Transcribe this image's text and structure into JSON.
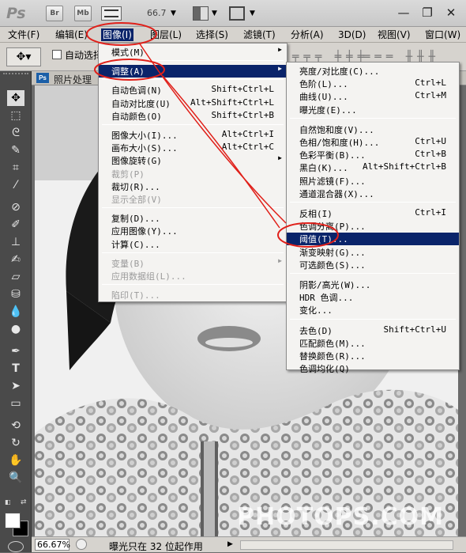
{
  "titlebar": {
    "app_logo": "Ps",
    "btn_bridge": "Br",
    "btn_minibridge": "Mb",
    "zoom": "66.7",
    "icons": [
      "screen-mode-icon",
      "arrange-icon",
      "extras-icon"
    ],
    "win_controls": [
      "minimize",
      "restore",
      "close"
    ]
  },
  "menubar": [
    {
      "label": "文件(F)"
    },
    {
      "label": "编辑(E)"
    },
    {
      "label": "图像(I)",
      "active": true
    },
    {
      "label": "图层(L)"
    },
    {
      "label": "选择(S)"
    },
    {
      "label": "滤镜(T)"
    },
    {
      "label": "分析(A)"
    },
    {
      "label": "3D(D)"
    },
    {
      "label": "视图(V)"
    },
    {
      "label": "窗口(W)"
    }
  ],
  "options": {
    "auto_select": "自动选择"
  },
  "document": {
    "tab_title": "照片处理"
  },
  "status": {
    "zoom": "66.67%",
    "message": "曝光只在 32 位起作用"
  },
  "image_menu": [
    {
      "label": "模式(M)",
      "sub": true
    },
    {
      "sep": true
    },
    {
      "label": "调整(A)",
      "sub": true,
      "hl": true
    },
    {
      "sep": true
    },
    {
      "label": "自动色调(N)",
      "sc": "Shift+Ctrl+L"
    },
    {
      "label": "自动对比度(U)",
      "sc": "Alt+Shift+Ctrl+L"
    },
    {
      "label": "自动颜色(O)",
      "sc": "Shift+Ctrl+B"
    },
    {
      "sep": true
    },
    {
      "label": "图像大小(I)...",
      "sc": "Alt+Ctrl+I"
    },
    {
      "label": "画布大小(S)...",
      "sc": "Alt+Ctrl+C"
    },
    {
      "label": "图像旋转(G)",
      "sub": true
    },
    {
      "label": "裁剪(P)",
      "dis": true
    },
    {
      "label": "裁切(R)..."
    },
    {
      "label": "显示全部(V)",
      "dis": true
    },
    {
      "sep": true
    },
    {
      "label": "复制(D)..."
    },
    {
      "label": "应用图像(Y)..."
    },
    {
      "label": "计算(C)..."
    },
    {
      "sep": true
    },
    {
      "label": "变量(B)",
      "sub": true,
      "dis": true
    },
    {
      "label": "应用数据组(L)...",
      "dis": true
    },
    {
      "sep": true
    },
    {
      "label": "陷印(T)...",
      "dis": true
    }
  ],
  "adjust_menu": [
    {
      "label": "亮度/对比度(C)..."
    },
    {
      "label": "色阶(L)...",
      "sc": "Ctrl+L"
    },
    {
      "label": "曲线(U)...",
      "sc": "Ctrl+M"
    },
    {
      "label": "曝光度(E)..."
    },
    {
      "sep": true
    },
    {
      "label": "自然饱和度(V)..."
    },
    {
      "label": "色相/饱和度(H)...",
      "sc": "Ctrl+U"
    },
    {
      "label": "色彩平衡(B)...",
      "sc": "Ctrl+B"
    },
    {
      "label": "黑白(K)...",
      "sc": "Alt+Shift+Ctrl+B"
    },
    {
      "label": "照片滤镜(F)..."
    },
    {
      "label": "通道混合器(X)..."
    },
    {
      "sep": true
    },
    {
      "label": "反相(I)",
      "sc": "Ctrl+I"
    },
    {
      "label": "色调分离(P)..."
    },
    {
      "label": "阈值(T)...",
      "hl": true
    },
    {
      "label": "渐变映射(G)..."
    },
    {
      "label": "可选颜色(S)..."
    },
    {
      "sep": true
    },
    {
      "label": "阴影/高光(W)..."
    },
    {
      "label": "HDR 色调..."
    },
    {
      "label": "变化..."
    },
    {
      "sep": true
    },
    {
      "label": "去色(D)",
      "sc": "Shift+Ctrl+U"
    },
    {
      "label": "匹配颜色(M)..."
    },
    {
      "label": "替换颜色(R)..."
    },
    {
      "label": "色调均化(Q)"
    }
  ],
  "watermark": "PHOTOPS.COM",
  "colors": {
    "highlight": "#0a246a",
    "annotation": "#e0201a",
    "menu_bg": "#f4f3f1"
  }
}
